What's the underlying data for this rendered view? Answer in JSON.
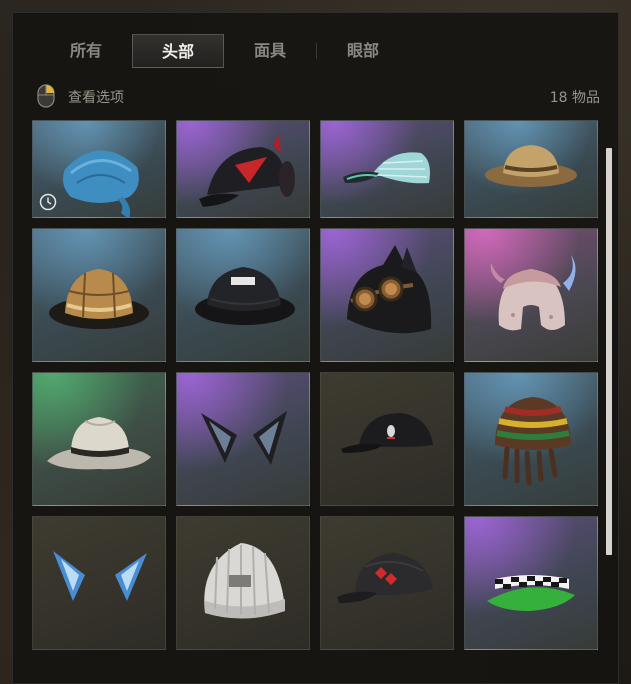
{
  "tabs": [
    {
      "label": "所有"
    },
    {
      "label": "头部"
    },
    {
      "label": "面具"
    },
    {
      "label": "眼部"
    }
  ],
  "active_tab": "头部",
  "subbar": {
    "view_options": "查看选项",
    "item_count": "18 物品"
  },
  "items": [
    {
      "icon": "blue-bandana-icon",
      "rarity": "blue"
    },
    {
      "icon": "black-red-cap-icon",
      "rarity": "purple"
    },
    {
      "icon": "striped-teal-cap-icon",
      "rarity": "purple"
    },
    {
      "icon": "tan-bucket-hat-icon",
      "rarity": "blue"
    },
    {
      "icon": "brown-bucket-hat-icon",
      "rarity": "blue"
    },
    {
      "icon": "black-bucket-hat-icon",
      "rarity": "blue"
    },
    {
      "icon": "cat-ear-goggle-beanie-icon",
      "rarity": "purple"
    },
    {
      "icon": "horned-trapper-hat-icon",
      "rarity": "pink"
    },
    {
      "icon": "white-fedora-icon",
      "rarity": "green"
    },
    {
      "icon": "black-cat-ears-icon",
      "rarity": "purple"
    },
    {
      "icon": "black-baseball-cap-icon",
      "rarity": "plain"
    },
    {
      "icon": "rasta-beanie-icon",
      "rarity": "blue"
    },
    {
      "icon": "blue-cat-ears-icon",
      "rarity": "plain"
    },
    {
      "icon": "white-knit-beanie-icon",
      "rarity": "plain"
    },
    {
      "icon": "dark-red-logo-cap-icon",
      "rarity": "plain"
    },
    {
      "icon": "checkered-visor-icon",
      "rarity": "purple"
    }
  ],
  "colors": {
    "active_tab_text": "#f1ede6",
    "inactive_tab_text": "#8b8680",
    "scrollbar_thumb": "#d7d4cf"
  }
}
